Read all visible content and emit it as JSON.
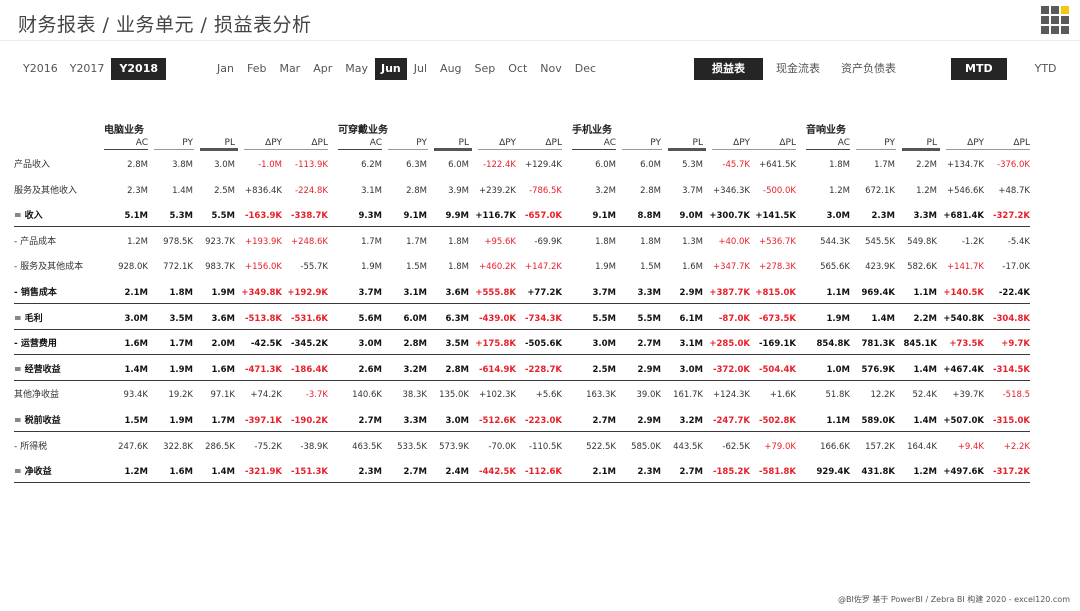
{
  "title": "财务报表 / 业务单元 / 损益表分析",
  "brand": {
    "accent": "#f2c811",
    "dark": "#252525",
    "negative": "#e8202a"
  },
  "logo_icon": "grid-app-icon",
  "years": {
    "options": [
      "Y2016",
      "Y2017",
      "Y2018"
    ],
    "selected": "Y2018"
  },
  "months": {
    "options": [
      "Jan",
      "Feb",
      "Mar",
      "Apr",
      "May",
      "Jun",
      "Jul",
      "Aug",
      "Sep",
      "Oct",
      "Nov",
      "Dec"
    ],
    "selected": "Jun"
  },
  "statements": {
    "options": [
      "损益表",
      "现金流表",
      "资产负债表"
    ],
    "selected": "损益表"
  },
  "periods": {
    "options": [
      "MTD",
      "YTD"
    ],
    "selected": "MTD"
  },
  "columns": [
    "AC",
    "PY",
    "PL",
    "ΔPY",
    "ΔPL"
  ],
  "segments": [
    "电脑业务",
    "可穿戴业务",
    "手机业务",
    "音响业务"
  ],
  "rows": [
    {
      "label": "产品收入",
      "bold": false,
      "values": [
        [
          "2.8M",
          "3.8M",
          "3.0M",
          "-1.0M",
          "-113.9K"
        ],
        [
          "6.2M",
          "6.3M",
          "6.0M",
          "-122.4K",
          "+129.4K"
        ],
        [
          "6.0M",
          "6.0M",
          "5.3M",
          "-45.7K",
          "+641.5K"
        ],
        [
          "1.8M",
          "1.7M",
          "2.2M",
          "+134.7K",
          "-376.0K"
        ]
      ]
    },
    {
      "label": "服务及其他收入",
      "bold": false,
      "values": [
        [
          "2.3M",
          "1.4M",
          "2.5M",
          "+836.4K",
          "-224.8K"
        ],
        [
          "3.1M",
          "2.8M",
          "3.9M",
          "+239.2K",
          "-786.5K"
        ],
        [
          "3.2M",
          "2.8M",
          "3.7M",
          "+346.3K",
          "-500.0K"
        ],
        [
          "1.2M",
          "672.1K",
          "1.2M",
          "+546.6K",
          "+48.7K"
        ]
      ]
    },
    {
      "label": "= 收入",
      "bold": true,
      "values": [
        [
          "5.1M",
          "5.3M",
          "5.5M",
          "-163.9K",
          "-338.7K"
        ],
        [
          "9.3M",
          "9.1M",
          "9.9M",
          "+116.7K",
          "-657.0K"
        ],
        [
          "9.1M",
          "8.8M",
          "9.0M",
          "+300.7K",
          "+141.5K"
        ],
        [
          "3.0M",
          "2.3M",
          "3.3M",
          "+681.4K",
          "-327.2K"
        ]
      ]
    },
    {
      "label": "- 产品成本",
      "bold": false,
      "values": [
        [
          "1.2M",
          "978.5K",
          "923.7K",
          "+193.9K",
          "+248.6K"
        ],
        [
          "1.7M",
          "1.7M",
          "1.8M",
          "+95.6K",
          "-69.9K"
        ],
        [
          "1.8M",
          "1.8M",
          "1.3M",
          "+40.0K",
          "+536.7K"
        ],
        [
          "544.3K",
          "545.5K",
          "549.8K",
          "-1.2K",
          "-5.4K"
        ]
      ]
    },
    {
      "label": "- 服务及其他成本",
      "bold": false,
      "values": [
        [
          "928.0K",
          "772.1K",
          "983.7K",
          "+156.0K",
          "-55.7K"
        ],
        [
          "1.9M",
          "1.5M",
          "1.8M",
          "+460.2K",
          "+147.2K"
        ],
        [
          "1.9M",
          "1.5M",
          "1.6M",
          "+347.7K",
          "+278.3K"
        ],
        [
          "565.6K",
          "423.9K",
          "582.6K",
          "+141.7K",
          "-17.0K"
        ]
      ]
    },
    {
      "label": "- 销售成本",
      "bold": true,
      "values": [
        [
          "2.1M",
          "1.8M",
          "1.9M",
          "+349.8K",
          "+192.9K"
        ],
        [
          "3.7M",
          "3.1M",
          "3.6M",
          "+555.8K",
          "+77.2K"
        ],
        [
          "3.7M",
          "3.3M",
          "2.9M",
          "+387.7K",
          "+815.0K"
        ],
        [
          "1.1M",
          "969.4K",
          "1.1M",
          "+140.5K",
          "-22.4K"
        ]
      ]
    },
    {
      "label": "= 毛利",
      "bold": true,
      "values": [
        [
          "3.0M",
          "3.5M",
          "3.6M",
          "-513.8K",
          "-531.6K"
        ],
        [
          "5.6M",
          "6.0M",
          "6.3M",
          "-439.0K",
          "-734.3K"
        ],
        [
          "5.5M",
          "5.5M",
          "6.1M",
          "-87.0K",
          "-673.5K"
        ],
        [
          "1.9M",
          "1.4M",
          "2.2M",
          "+540.8K",
          "-304.8K"
        ]
      ]
    },
    {
      "label": "- 运营费用",
      "bold": true,
      "values": [
        [
          "1.6M",
          "1.7M",
          "2.0M",
          "-42.5K",
          "-345.2K"
        ],
        [
          "3.0M",
          "2.8M",
          "3.5M",
          "+175.8K",
          "-505.6K"
        ],
        [
          "3.0M",
          "2.7M",
          "3.1M",
          "+285.0K",
          "-169.1K"
        ],
        [
          "854.8K",
          "781.3K",
          "845.1K",
          "+73.5K",
          "+9.7K"
        ]
      ]
    },
    {
      "label": "= 经营收益",
      "bold": true,
      "values": [
        [
          "1.4M",
          "1.9M",
          "1.6M",
          "-471.3K",
          "-186.4K"
        ],
        [
          "2.6M",
          "3.2M",
          "2.8M",
          "-614.9K",
          "-228.7K"
        ],
        [
          "2.5M",
          "2.9M",
          "3.0M",
          "-372.0K",
          "-504.4K"
        ],
        [
          "1.0M",
          "576.9K",
          "1.4M",
          "+467.4K",
          "-314.5K"
        ]
      ]
    },
    {
      "label": "其他净收益",
      "bold": false,
      "values": [
        [
          "93.4K",
          "19.2K",
          "97.1K",
          "+74.2K",
          "-3.7K"
        ],
        [
          "140.6K",
          "38.3K",
          "135.0K",
          "+102.3K",
          "+5.6K"
        ],
        [
          "163.3K",
          "39.0K",
          "161.7K",
          "+124.3K",
          "+1.6K"
        ],
        [
          "51.8K",
          "12.2K",
          "52.4K",
          "+39.7K",
          "-518.5"
        ]
      ]
    },
    {
      "label": "= 税前收益",
      "bold": true,
      "values": [
        [
          "1.5M",
          "1.9M",
          "1.7M",
          "-397.1K",
          "-190.2K"
        ],
        [
          "2.7M",
          "3.3M",
          "3.0M",
          "-512.6K",
          "-223.0K"
        ],
        [
          "2.7M",
          "2.9M",
          "3.2M",
          "-247.7K",
          "-502.8K"
        ],
        [
          "1.1M",
          "589.0K",
          "1.4M",
          "+507.0K",
          "-315.0K"
        ]
      ]
    },
    {
      "label": "- 所得税",
      "bold": false,
      "values": [
        [
          "247.6K",
          "322.8K",
          "286.5K",
          "-75.2K",
          "-38.9K"
        ],
        [
          "463.5K",
          "533.5K",
          "573.9K",
          "-70.0K",
          "-110.5K"
        ],
        [
          "522.5K",
          "585.0K",
          "443.5K",
          "-62.5K",
          "+79.0K"
        ],
        [
          "166.6K",
          "157.2K",
          "164.4K",
          "+9.4K",
          "+2.2K"
        ]
      ]
    },
    {
      "label": "= 净收益",
      "bold": true,
      "values": [
        [
          "1.2M",
          "1.6M",
          "1.4M",
          "-321.9K",
          "-151.3K"
        ],
        [
          "2.3M",
          "2.7M",
          "2.4M",
          "-442.5K",
          "-112.6K"
        ],
        [
          "2.1M",
          "2.3M",
          "2.7M",
          "-185.2K",
          "-581.8K"
        ],
        [
          "929.4K",
          "431.8K",
          "1.2M",
          "+497.6K",
          "-317.2K"
        ]
      ]
    }
  ],
  "negative_flags": [
    [
      [
        0,
        0,
        0,
        1,
        1
      ],
      [
        0,
        0,
        0,
        1,
        0
      ],
      [
        0,
        0,
        0,
        1,
        0
      ],
      [
        0,
        0,
        0,
        0,
        1
      ]
    ],
    [
      [
        0,
        0,
        0,
        0,
        1
      ],
      [
        0,
        0,
        0,
        0,
        1
      ],
      [
        0,
        0,
        0,
        0,
        1
      ],
      [
        0,
        0,
        0,
        0,
        0
      ]
    ],
    [
      [
        0,
        0,
        0,
        1,
        1
      ],
      [
        0,
        0,
        0,
        0,
        1
      ],
      [
        0,
        0,
        0,
        0,
        0
      ],
      [
        0,
        0,
        0,
        0,
        1
      ]
    ],
    [
      [
        0,
        0,
        0,
        1,
        1
      ],
      [
        0,
        0,
        0,
        1,
        0
      ],
      [
        0,
        0,
        0,
        1,
        1
      ],
      [
        0,
        0,
        0,
        0,
        0
      ]
    ],
    [
      [
        0,
        0,
        0,
        1,
        0
      ],
      [
        0,
        0,
        0,
        1,
        1
      ],
      [
        0,
        0,
        0,
        1,
        1
      ],
      [
        0,
        0,
        0,
        1,
        0
      ]
    ],
    [
      [
        0,
        0,
        0,
        1,
        1
      ],
      [
        0,
        0,
        0,
        1,
        0
      ],
      [
        0,
        0,
        0,
        1,
        1
      ],
      [
        0,
        0,
        0,
        1,
        0
      ]
    ],
    [
      [
        0,
        0,
        0,
        1,
        1
      ],
      [
        0,
        0,
        0,
        1,
        1
      ],
      [
        0,
        0,
        0,
        1,
        1
      ],
      [
        0,
        0,
        0,
        0,
        1
      ]
    ],
    [
      [
        0,
        0,
        0,
        0,
        0
      ],
      [
        0,
        0,
        0,
        1,
        0
      ],
      [
        0,
        0,
        0,
        1,
        0
      ],
      [
        0,
        0,
        0,
        1,
        1
      ]
    ],
    [
      [
        0,
        0,
        0,
        1,
        1
      ],
      [
        0,
        0,
        0,
        1,
        1
      ],
      [
        0,
        0,
        0,
        1,
        1
      ],
      [
        0,
        0,
        0,
        0,
        1
      ]
    ],
    [
      [
        0,
        0,
        0,
        0,
        1
      ],
      [
        0,
        0,
        0,
        0,
        0
      ],
      [
        0,
        0,
        0,
        0,
        0
      ],
      [
        0,
        0,
        0,
        0,
        1
      ]
    ],
    [
      [
        0,
        0,
        0,
        1,
        1
      ],
      [
        0,
        0,
        0,
        1,
        1
      ],
      [
        0,
        0,
        0,
        1,
        1
      ],
      [
        0,
        0,
        0,
        0,
        1
      ]
    ],
    [
      [
        0,
        0,
        0,
        0,
        0
      ],
      [
        0,
        0,
        0,
        0,
        0
      ],
      [
        0,
        0,
        0,
        0,
        1
      ],
      [
        0,
        0,
        0,
        1,
        1
      ]
    ],
    [
      [
        0,
        0,
        0,
        1,
        1
      ],
      [
        0,
        0,
        0,
        1,
        1
      ],
      [
        0,
        0,
        0,
        1,
        1
      ],
      [
        0,
        0,
        0,
        0,
        1
      ]
    ]
  ],
  "footer": "@BI佐罗   基于 PowerBI / Zebra BI 构建 2020 - excel120.com"
}
